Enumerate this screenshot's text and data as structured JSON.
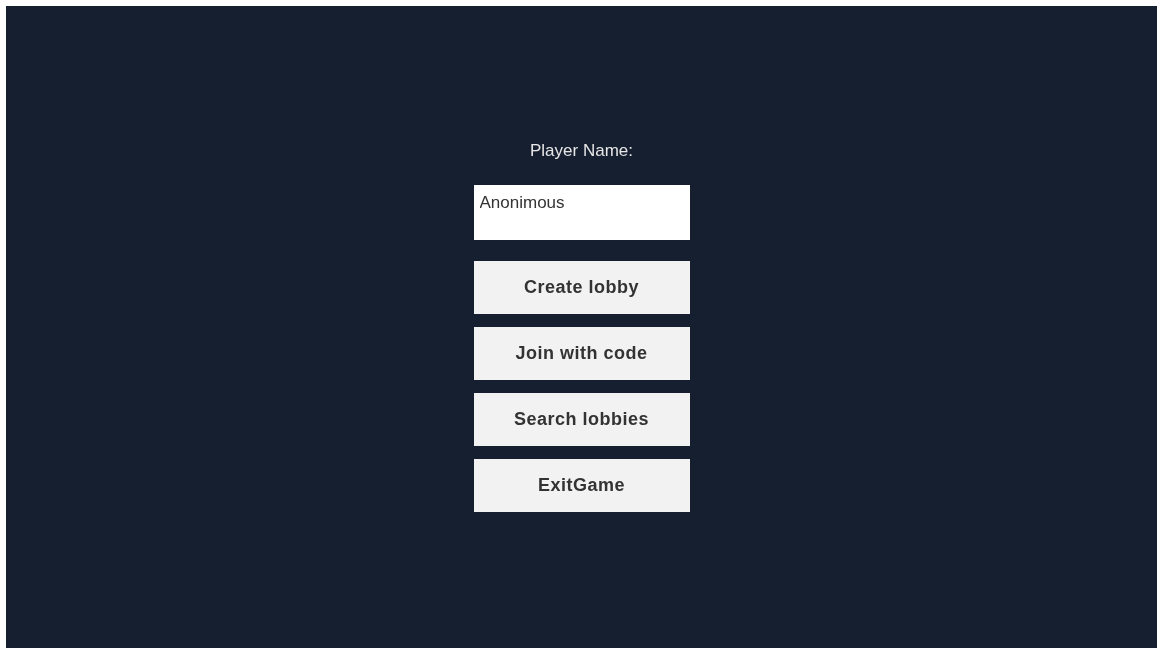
{
  "name_label": "Player Name:",
  "name_field": {
    "value": "Anonimous"
  },
  "buttons": [
    {
      "label": "Create lobby"
    },
    {
      "label": "Join with code"
    },
    {
      "label": "Search lobbies"
    },
    {
      "label": "ExitGame"
    }
  ]
}
